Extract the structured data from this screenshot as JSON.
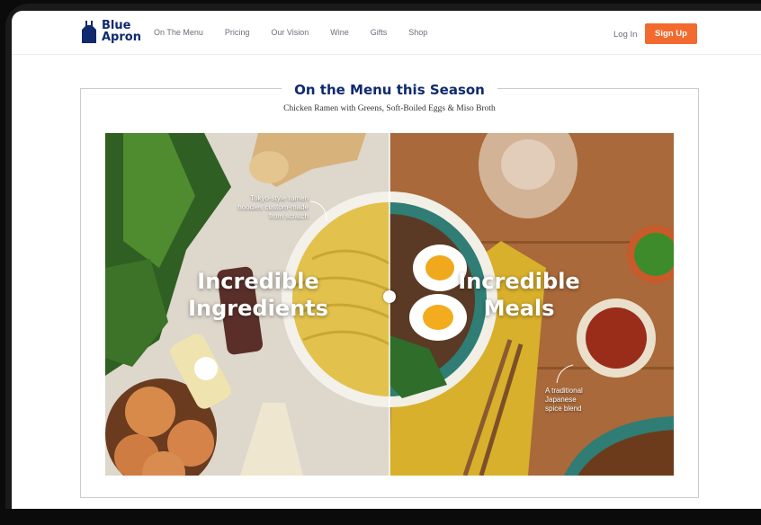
{
  "brand": {
    "name": "Blue Apron",
    "color": "#0f2a6e"
  },
  "nav": {
    "links": [
      "On The Menu",
      "Pricing",
      "Our Vision",
      "Wine",
      "Gifts",
      "Shop"
    ],
    "login_label": "Log In",
    "signup_label": "Sign Up",
    "accent": "#f26a2e"
  },
  "section": {
    "title": "On the Menu this Season",
    "subtitle": "Chicken Ramen with Greens, Soft-Boiled Eggs & Miso Broth"
  },
  "hero": {
    "left_label_line1": "Incredible",
    "left_label_line2": "Ingredients",
    "right_label_line1": "Incredible",
    "right_label_line2": "Meals",
    "callout_noodles_line1": "Tokyo-style ramen",
    "callout_noodles_line2": "noodles custom-made",
    "callout_noodles_line3": "from scratch",
    "callout_spice_line1": "A traditional",
    "callout_spice_line2": "Japanese",
    "callout_spice_line3": "spice blend"
  }
}
